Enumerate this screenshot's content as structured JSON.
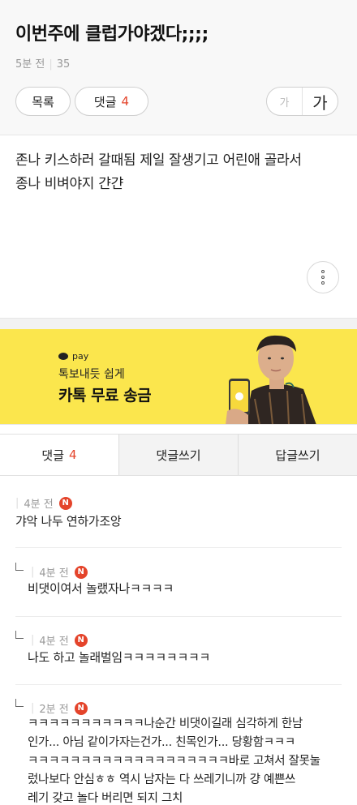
{
  "post": {
    "title": "이번주에 클럽가야겠다;;;;",
    "time": "5분 전",
    "views": "35",
    "list_label": "목록",
    "comment_label": "댓글",
    "comment_count": "4",
    "font_small": "가",
    "font_large": "가",
    "body_line1": "존나 키스하러 갈때됨 제일 잘생기고 어린애 골라서",
    "body_line2": "종나 비벼야지 갼갼"
  },
  "ad": {
    "pay": "pay",
    "subtitle": "톡보내듯 쉽게",
    "headline": "카톡 무료 송금"
  },
  "tabs": {
    "comments_label": "댓글",
    "comments_count": "4",
    "write_comment": "댓글쓰기",
    "write_reply": "답글쓰기"
  },
  "comments": [
    {
      "time": "4분 전",
      "badge": "N",
      "text": "갸악 나두 연하가조앙",
      "reply": false
    },
    {
      "time": "4분 전",
      "badge": "N",
      "text": "비댓이여서 놀랬자나ㅋㅋㅋㅋ",
      "reply": true
    },
    {
      "time": "4분 전",
      "badge": "N",
      "text": "나도 하고 놀래벌임ㅋㅋㅋㅋㅋㅋㅋㅋ",
      "reply": true
    },
    {
      "time": "2분 전",
      "badge": "N",
      "reply": true,
      "lines": [
        "ㅋㅋㅋㅋㅋㅋㅋㅋㅋㅋㅋ나순간 비댓이길래 심각하게 한남",
        "인가... 아님 같이가자는건가... 친목인가... 당황함ㅋㅋㅋ",
        "ㅋㅋㅋㅋㅋㅋㅋㅋㅋㅋㅋㅋㅋㅋㅋㅋㅋㅋㅋ바로 고쳐서 잘못눌",
        "렀나보다 안심ㅎㅎ 역시 남자는 다 쓰레기니까 걍 예쁜쓰",
        "레기 갖고 놀다 버리면 되지 그치"
      ]
    }
  ],
  "colors": {
    "accent_red": "#e4442b",
    "ad_yellow": "#fbe64d"
  }
}
